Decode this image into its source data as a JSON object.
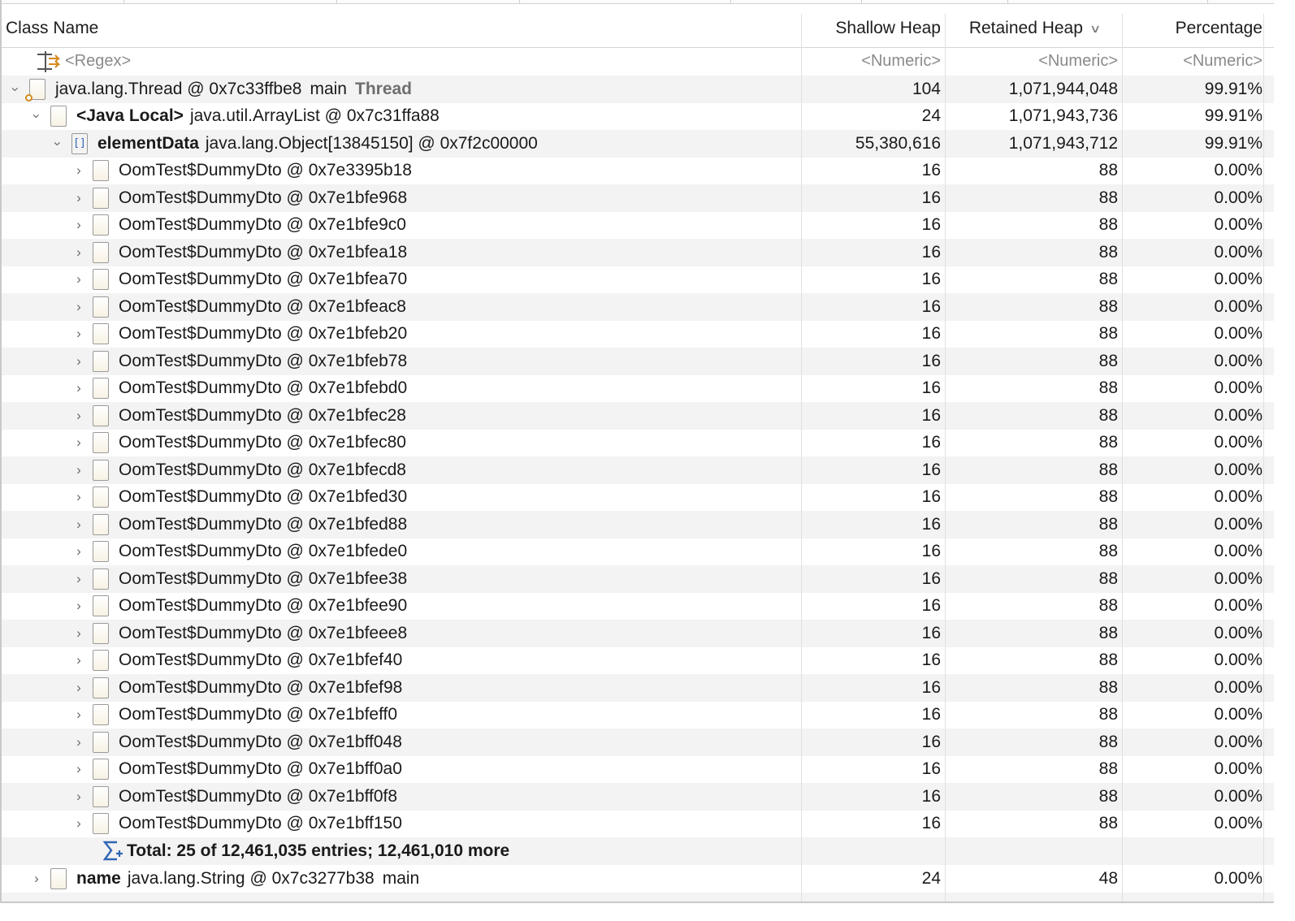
{
  "columns": {
    "class_name": "Class Name",
    "shallow_heap": "Shallow Heap",
    "retained_heap": "Retained Heap",
    "percentage": "Percentage"
  },
  "filter": {
    "name": "<Regex>",
    "shallow": "<Numeric>",
    "retained": "<Numeric>",
    "percentage": "<Numeric>"
  },
  "rows": [
    {
      "twisty": "expanded",
      "icon": "thread-object-icon",
      "label": "",
      "name": "java.lang.Thread @ 0x7c33ffbe8",
      "suffix": "main",
      "tag": "Thread",
      "shallow": "104",
      "retained": "1,071,944,048",
      "pct": "99.91%"
    },
    {
      "twisty": "expanded",
      "icon": "object-icon",
      "label": "<Java Local>",
      "name": "java.util.ArrayList @ 0x7c31ffa88",
      "suffix": "",
      "tag": "",
      "shallow": "24",
      "retained": "1,071,943,736",
      "pct": "99.91%"
    },
    {
      "twisty": "expanded",
      "icon": "array-icon",
      "label": "elementData",
      "name": "java.lang.Object[13845150] @ 0x7f2c00000",
      "suffix": "",
      "tag": "",
      "shallow": "55,380,616",
      "retained": "1,071,943,712",
      "pct": "99.91%"
    },
    {
      "name": "OomTest$DummyDto @ 0x7e3395b18",
      "shallow": "16",
      "retained": "88",
      "pct": "0.00%"
    },
    {
      "name": "OomTest$DummyDto @ 0x7e1bfe968",
      "shallow": "16",
      "retained": "88",
      "pct": "0.00%"
    },
    {
      "name": "OomTest$DummyDto @ 0x7e1bfe9c0",
      "shallow": "16",
      "retained": "88",
      "pct": "0.00%"
    },
    {
      "name": "OomTest$DummyDto @ 0x7e1bfea18",
      "shallow": "16",
      "retained": "88",
      "pct": "0.00%"
    },
    {
      "name": "OomTest$DummyDto @ 0x7e1bfea70",
      "shallow": "16",
      "retained": "88",
      "pct": "0.00%"
    },
    {
      "name": "OomTest$DummyDto @ 0x7e1bfeac8",
      "shallow": "16",
      "retained": "88",
      "pct": "0.00%"
    },
    {
      "name": "OomTest$DummyDto @ 0x7e1bfeb20",
      "shallow": "16",
      "retained": "88",
      "pct": "0.00%"
    },
    {
      "name": "OomTest$DummyDto @ 0x7e1bfeb78",
      "shallow": "16",
      "retained": "88",
      "pct": "0.00%"
    },
    {
      "name": "OomTest$DummyDto @ 0x7e1bfebd0",
      "shallow": "16",
      "retained": "88",
      "pct": "0.00%"
    },
    {
      "name": "OomTest$DummyDto @ 0x7e1bfec28",
      "shallow": "16",
      "retained": "88",
      "pct": "0.00%"
    },
    {
      "name": "OomTest$DummyDto @ 0x7e1bfec80",
      "shallow": "16",
      "retained": "88",
      "pct": "0.00%"
    },
    {
      "name": "OomTest$DummyDto @ 0x7e1bfecd8",
      "shallow": "16",
      "retained": "88",
      "pct": "0.00%"
    },
    {
      "name": "OomTest$DummyDto @ 0x7e1bfed30",
      "shallow": "16",
      "retained": "88",
      "pct": "0.00%"
    },
    {
      "name": "OomTest$DummyDto @ 0x7e1bfed88",
      "shallow": "16",
      "retained": "88",
      "pct": "0.00%"
    },
    {
      "name": "OomTest$DummyDto @ 0x7e1bfede0",
      "shallow": "16",
      "retained": "88",
      "pct": "0.00%"
    },
    {
      "name": "OomTest$DummyDto @ 0x7e1bfee38",
      "shallow": "16",
      "retained": "88",
      "pct": "0.00%"
    },
    {
      "name": "OomTest$DummyDto @ 0x7e1bfee90",
      "shallow": "16",
      "retained": "88",
      "pct": "0.00%"
    },
    {
      "name": "OomTest$DummyDto @ 0x7e1bfeee8",
      "shallow": "16",
      "retained": "88",
      "pct": "0.00%"
    },
    {
      "name": "OomTest$DummyDto @ 0x7e1bfef40",
      "shallow": "16",
      "retained": "88",
      "pct": "0.00%"
    },
    {
      "name": "OomTest$DummyDto @ 0x7e1bfef98",
      "shallow": "16",
      "retained": "88",
      "pct": "0.00%"
    },
    {
      "name": "OomTest$DummyDto @ 0x7e1bfeff0",
      "shallow": "16",
      "retained": "88",
      "pct": "0.00%"
    },
    {
      "name": "OomTest$DummyDto @ 0x7e1bff048",
      "shallow": "16",
      "retained": "88",
      "pct": "0.00%"
    },
    {
      "name": "OomTest$DummyDto @ 0x7e1bff0a0",
      "shallow": "16",
      "retained": "88",
      "pct": "0.00%"
    },
    {
      "name": "OomTest$DummyDto @ 0x7e1bff0f8",
      "shallow": "16",
      "retained": "88",
      "pct": "0.00%"
    },
    {
      "name": "OomTest$DummyDto @ 0x7e1bff150",
      "shallow": "16",
      "retained": "88",
      "pct": "0.00%"
    }
  ],
  "total": {
    "icon": "sigma-icon",
    "text": "Total: 25 of 12,461,035 entries; 12,461,010 more"
  },
  "after_rows": [
    {
      "twisty": "collapsed",
      "icon": "object-icon",
      "label": "name",
      "name": "java.lang.String @ 0x7c3277b38",
      "suffix": "main",
      "shallow": "24",
      "retained": "48",
      "pct": "0.00%"
    }
  ],
  "colors": {
    "thread_tag": "#6e6e6e",
    "array_icon": "#2f66b5",
    "thread_badge": "#d38a1e"
  }
}
